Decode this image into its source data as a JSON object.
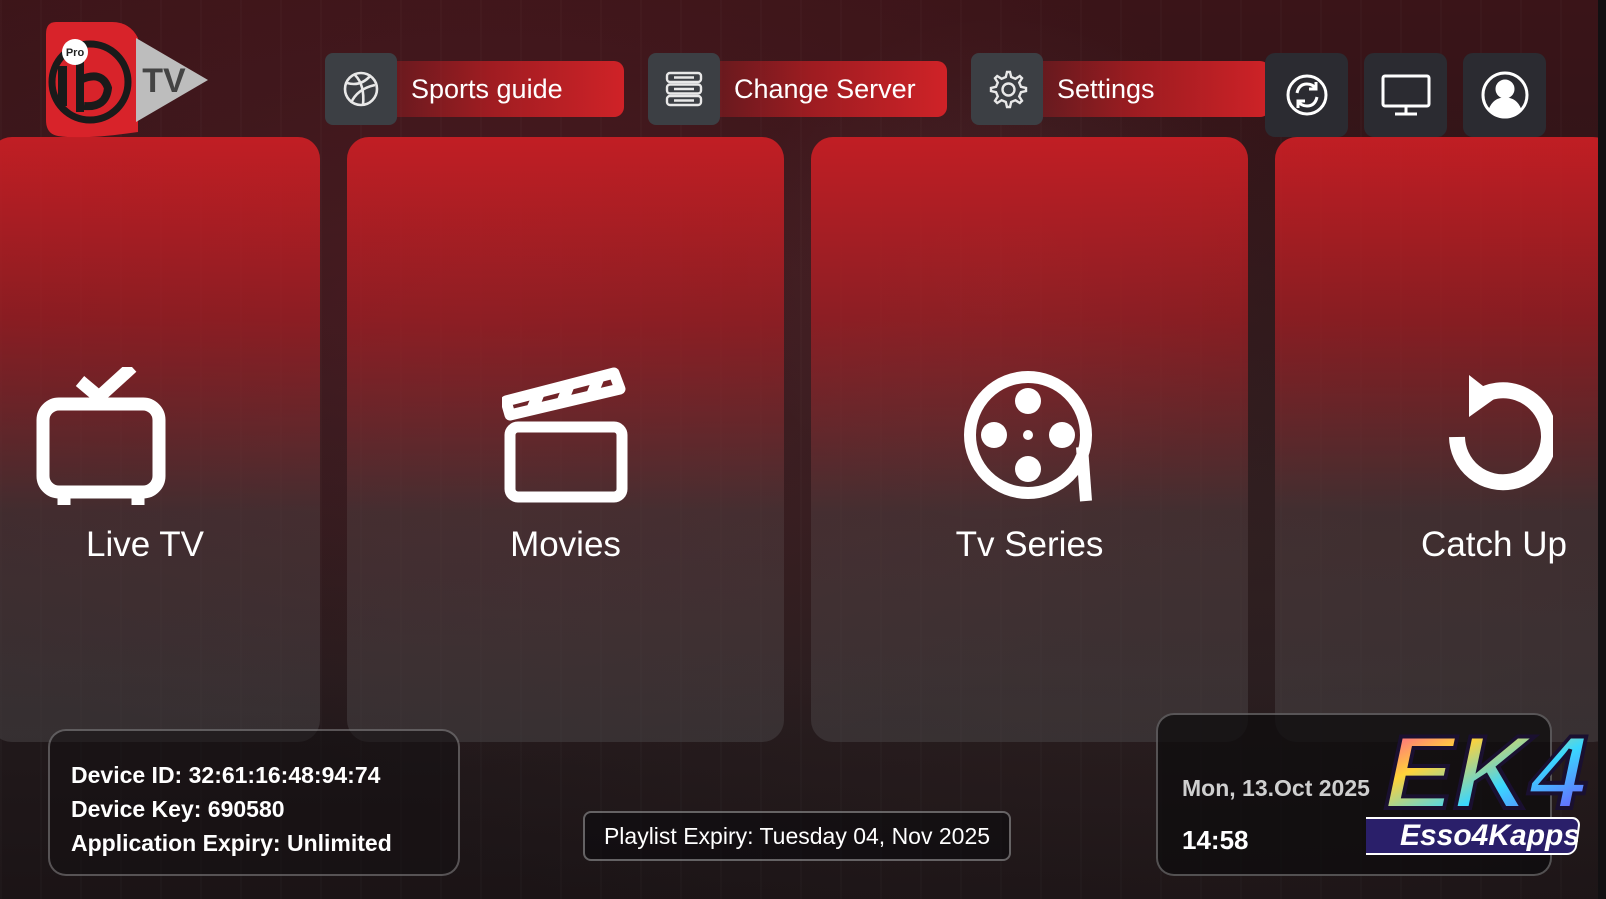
{
  "app": {
    "logo_badge": "Pro",
    "logo_text": "TV"
  },
  "top_menu": {
    "sports_guide": "Sports guide",
    "change_server": "Change Server",
    "settings": "Settings",
    "icons": [
      "basketball-icon",
      "server-list-icon",
      "gear-icon",
      "refresh-icon",
      "monitor-icon",
      "user-icon"
    ]
  },
  "cards": [
    {
      "label": "Live TV",
      "icon": "tv-icon"
    },
    {
      "label": "Movies",
      "icon": "clapperboard-icon"
    },
    {
      "label": "Tv Series",
      "icon": "film-reel-icon"
    },
    {
      "label": "Catch Up",
      "icon": "replay-icon"
    }
  ],
  "device": {
    "id_line": "Device ID: 32:61:16:48:94:74",
    "key_line": "Device Key: 690580",
    "expiry_line": "Application Expiry: Unlimited"
  },
  "playlist": {
    "expiry": "Playlist Expiry: Tuesday 04, Nov 2025"
  },
  "clock": {
    "date": "Mon, 13.Oct 2025",
    "time": "14:58"
  },
  "watermark": {
    "line1": "EK4",
    "line2": "Esso4Kapps"
  },
  "colors": {
    "accent_red": "#d8232a",
    "button_dark": "#3c3f44",
    "square_button": "#2b2b31"
  }
}
